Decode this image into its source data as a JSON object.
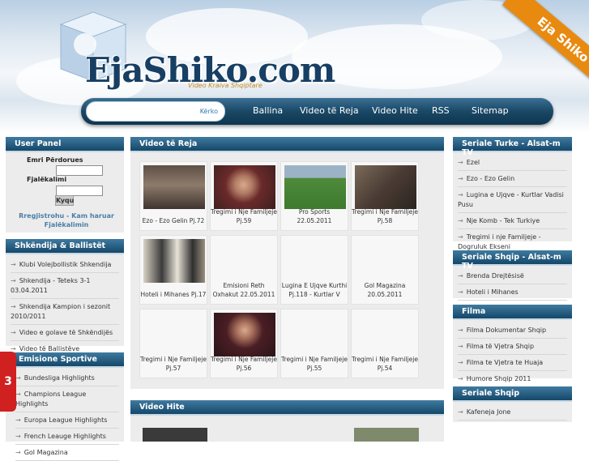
{
  "header": {
    "logo": "EjaShiko.com",
    "tagline": "Video Kraiva Shqiptare",
    "ribbon": "Eja Shiko"
  },
  "nav": {
    "search_button": "Kërko",
    "search_placeholder": "",
    "links": [
      "Ballina",
      "Video të Reja",
      "Video Hite",
      "RSS",
      "Sitemap"
    ]
  },
  "user_panel": {
    "title": "User Panel",
    "username_label": "Emri Përdorues",
    "password_label": "Fjalëkalimi",
    "login_button": "Kyqu",
    "register_line1": "Rregjistrohu - Kam haruar",
    "register_line2": "Fjalëkalimin"
  },
  "shkendija": {
    "title": "Shkëndija & Ballistët",
    "items": [
      "Klubi Volejbollistik Shkendija",
      "Shkendija - Teteks 3-1 03.04.2011",
      "Shkendija Kampion i sezonit 2010/2011",
      "Video e golave të Shkëndijës",
      "Video të Ballistëve"
    ]
  },
  "sportive": {
    "title": "Emisione Sportive",
    "items": [
      "Bundesliga Highlights",
      "Champions League Highlights",
      "Europa League Highlights",
      "French Leauge Highlights",
      "Gol Magazina"
    ]
  },
  "video_reja": {
    "title": "Video të Reja",
    "items": [
      {
        "caption": "Ezo - Ezo Gelin Pj.72",
        "thumb": "ezo"
      },
      {
        "caption": "Tregimi i Nje Familjeje Pj.59",
        "thumb": "woman"
      },
      {
        "caption": "Pro Sports 22.05.2011",
        "thumb": "field"
      },
      {
        "caption": "Tregimi i Nje Familjeje Pj.58",
        "thumb": "drama"
      },
      {
        "caption": "Hoteli i Mihanes Pj.17",
        "thumb": "hotel"
      },
      {
        "caption": "Emisioni Reth Oxhakut 22.05.2011",
        "thumb": ""
      },
      {
        "caption": "Lugina E Ujqve Kurthi Pj.118 - Kurtlar V",
        "thumb": ""
      },
      {
        "caption": "Gol Magazina 20.05.2011",
        "thumb": ""
      },
      {
        "caption": "Tregimi i Nje Familjeje Pj.57",
        "thumb": ""
      },
      {
        "caption": "Tregimi i Nje Familjeje Pj.56",
        "thumb": "woman2"
      },
      {
        "caption": "Tregimi i Nje Familjeje Pj.55",
        "thumb": ""
      },
      {
        "caption": "Tregimi i Nje Familjeje Pj.54",
        "thumb": ""
      }
    ]
  },
  "video_hite": {
    "title": "Video Hite"
  },
  "turke": {
    "title": "Seriale Turke - Alsat-m TV",
    "items": [
      "Ezel",
      "Ezo - Ezo Gelin",
      "Lugina e Ujqve - Kurtlar Vadisi Pusu",
      "Nje Komb - Tek Turkiye",
      "Tregimi i nje Familjeje - Dogruluk Ekseni"
    ]
  },
  "shqip_alsat": {
    "title": "Seriale Shqip - Alsat-m TV",
    "items": [
      "Brenda Drejtësisë",
      "Hoteli i Mihanes"
    ]
  },
  "filma": {
    "title": "Filma",
    "items": [
      "Filma Dokumentar Shqip",
      "Filma të Vjetra Shqip",
      "Filma te Vjetra te Huaja",
      "Humore Shqip 2011"
    ]
  },
  "seriale_shqip": {
    "title": "Seriale Shqip",
    "items": [
      "Kafeneja Jone"
    ]
  },
  "side_tab": {
    "label": "3"
  }
}
